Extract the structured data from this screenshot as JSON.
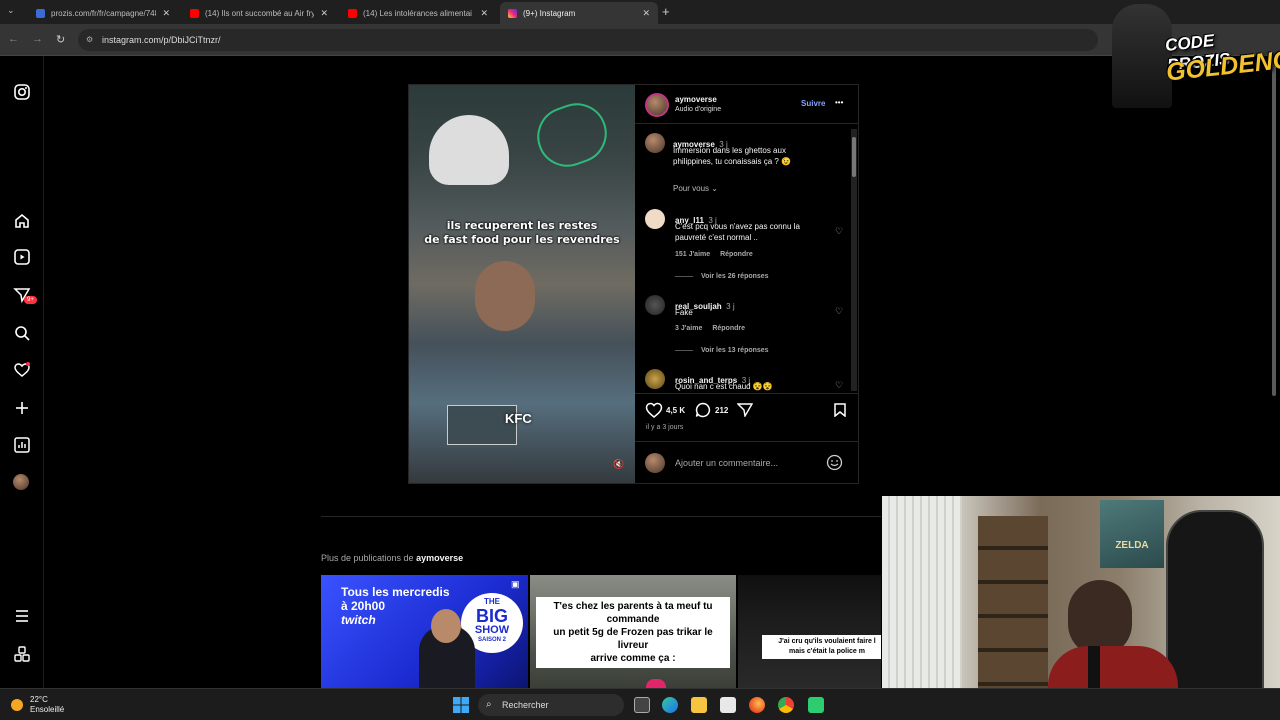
{
  "browser": {
    "tabs": [
      {
        "label": "prozis.com/fr/fr/campagne/748",
        "favicon_color": "#3b6bd4",
        "active": false
      },
      {
        "label": "(14) Ils ont succombé au Air fry",
        "favicon_color": "#ff0000",
        "active": false
      },
      {
        "label": "(14) Les intolérances alimentai",
        "favicon_color": "#ff0000",
        "active": false
      },
      {
        "label": "(9+) Instagram",
        "favicon_color": "#d6249f",
        "active": true
      }
    ],
    "new_tab": "+",
    "url": "instagram.com/p/DbiJCiTtnzr/"
  },
  "sidebar": {
    "icons": [
      "instagram-logo-icon",
      "home-icon",
      "reels-icon",
      "messages-icon",
      "search-icon",
      "notifications-icon",
      "create-icon",
      "dashboard-icon",
      "profile-avatar-icon",
      "menu-icon",
      "threads-icon"
    ],
    "messages_badge": "9+"
  },
  "post": {
    "video": {
      "caption_line1": "ils recuperent les restes",
      "caption_line2": "de fast food pour les revendres",
      "overlay_tag": "KFC"
    },
    "header": {
      "username": "aymoverse",
      "audio": "Audio d'origine",
      "follow_label": "Suivre",
      "more": "•••"
    },
    "caption": {
      "username": "aymoverse",
      "time": "3 j",
      "text_line1": "Immersion dans les ghettos aux",
      "text_line2": "philippines, tu conaissais ça ? 😉",
      "for_you": "Pour vous"
    },
    "comments": [
      {
        "username": "any_l11",
        "time": "3 j",
        "line1": "C'est pcq vous n'avez pas connu la",
        "line2": "pauvreté c'est normal ..",
        "likes": "151 J'aime",
        "reply": "Répondre",
        "see_replies": "Voir les 26 réponses"
      },
      {
        "username": "real_souljah",
        "time": "3 j",
        "line1": "Fake",
        "line2": "",
        "likes": "3 J'aime",
        "reply": "Répondre",
        "see_replies": "Voir les 13 réponses"
      },
      {
        "username": "rosin_and_terps",
        "time": "3 j",
        "line1": "Quoi nan c est chaud 😵😵",
        "line2": ""
      }
    ],
    "actions": {
      "likes": "4,5 K",
      "comments": "212"
    },
    "date": "il y a 3 jours",
    "add_comment_placeholder": "Ajouter un commentaire..."
  },
  "more_posts": {
    "heading_prefix": "Plus de publications de",
    "heading_user": "aymoverse",
    "thumbs": [
      {
        "line1": "Tous les mercredis",
        "line2": "à 20h00",
        "line3": "twitch",
        "show_top": "THE",
        "show_main": "BIG",
        "show_bottom": "SHOW",
        "season": "SAISON 2"
      },
      {
        "line1": "T'es chez les parents à ta meuf tu commande",
        "line2": "un petit 5g de Frozen pas trikar le livreur",
        "line3": "arrive comme ça :"
      },
      {
        "line1": "J'ai cru qu'ils voulaient faire l",
        "line2": "mais c'était la police m"
      }
    ]
  },
  "overlay_logo": {
    "line1": "CODE PROZIS",
    "line2": "GOLDENG"
  },
  "webcam": {
    "poster_text": "ZELDA"
  },
  "taskbar": {
    "temperature": "22°C",
    "weather": "Ensoleillé",
    "search_placeholder": "Rechercher"
  }
}
